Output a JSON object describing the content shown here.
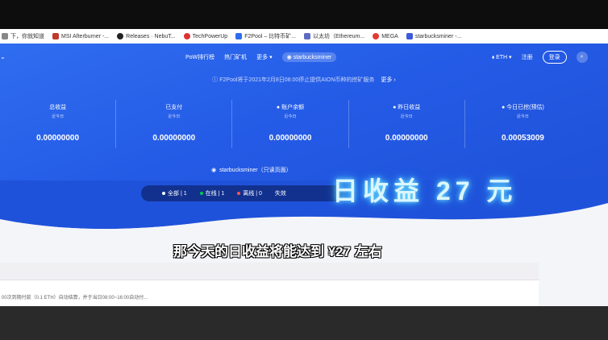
{
  "bookmarks": [
    {
      "label": "下，你就知道",
      "color": "#888888"
    },
    {
      "label": "MSI Afterburner -...",
      "color": "#c0392b"
    },
    {
      "label": "Releases · NebuT...",
      "color": "#222222"
    },
    {
      "label": "TechPowerUp",
      "color": "#d33"
    },
    {
      "label": "F2Pool – 比特币矿...",
      "color": "#2f6df0"
    },
    {
      "label": "以太坊（Ethereum...",
      "color": "#5c6bc0"
    },
    {
      "label": "MEGA",
      "color": "#e53935"
    },
    {
      "label": "starbucksminer -...",
      "color": "#3b5bdb"
    }
  ],
  "nav": {
    "links": [
      "PoW排行榜",
      "热门矿机",
      "更多 ▾"
    ],
    "account_pill": "starbucksminer",
    "coin": "ETH ▾",
    "register": "注册",
    "login": "登录"
  },
  "notice": {
    "text": "F2Pool将于2021年2月8日08:00停止提供AION币种的挖矿服务",
    "more": "更多 ›"
  },
  "stats": [
    {
      "label": "总收益",
      "sub": "近今日",
      "value": "0.00000000"
    },
    {
      "label": "已支付",
      "sub": "近今日",
      "value": "0.00000000"
    },
    {
      "label": "账户余额",
      "sub": "近今日",
      "value": "0.00000000"
    },
    {
      "label": "昨日收益",
      "sub": "近今日",
      "value": "0.00000000"
    },
    {
      "label": "今日已挖(预估)",
      "sub": "近今日",
      "value": "0.00053009"
    }
  ],
  "account": "starbucksminer（只读页面）",
  "filter": {
    "all": "全部",
    "all_count": "1",
    "online": "在线",
    "online_count": "1",
    "offline": "离线",
    "offline_count": "0",
    "invalid": "失效"
  },
  "overlay_text": "日收益 27 元",
  "payout_note": "00次到期付款（0.1 ETH）自动结算，并于当日08:00~16:00自动付...",
  "subtitle": "那今天的日收益将能达到 ¥27 左右",
  "colors": {
    "hero": "#245be6",
    "filter_bg": "#12318f",
    "online": "#00c853",
    "offline": "#ff5252"
  }
}
